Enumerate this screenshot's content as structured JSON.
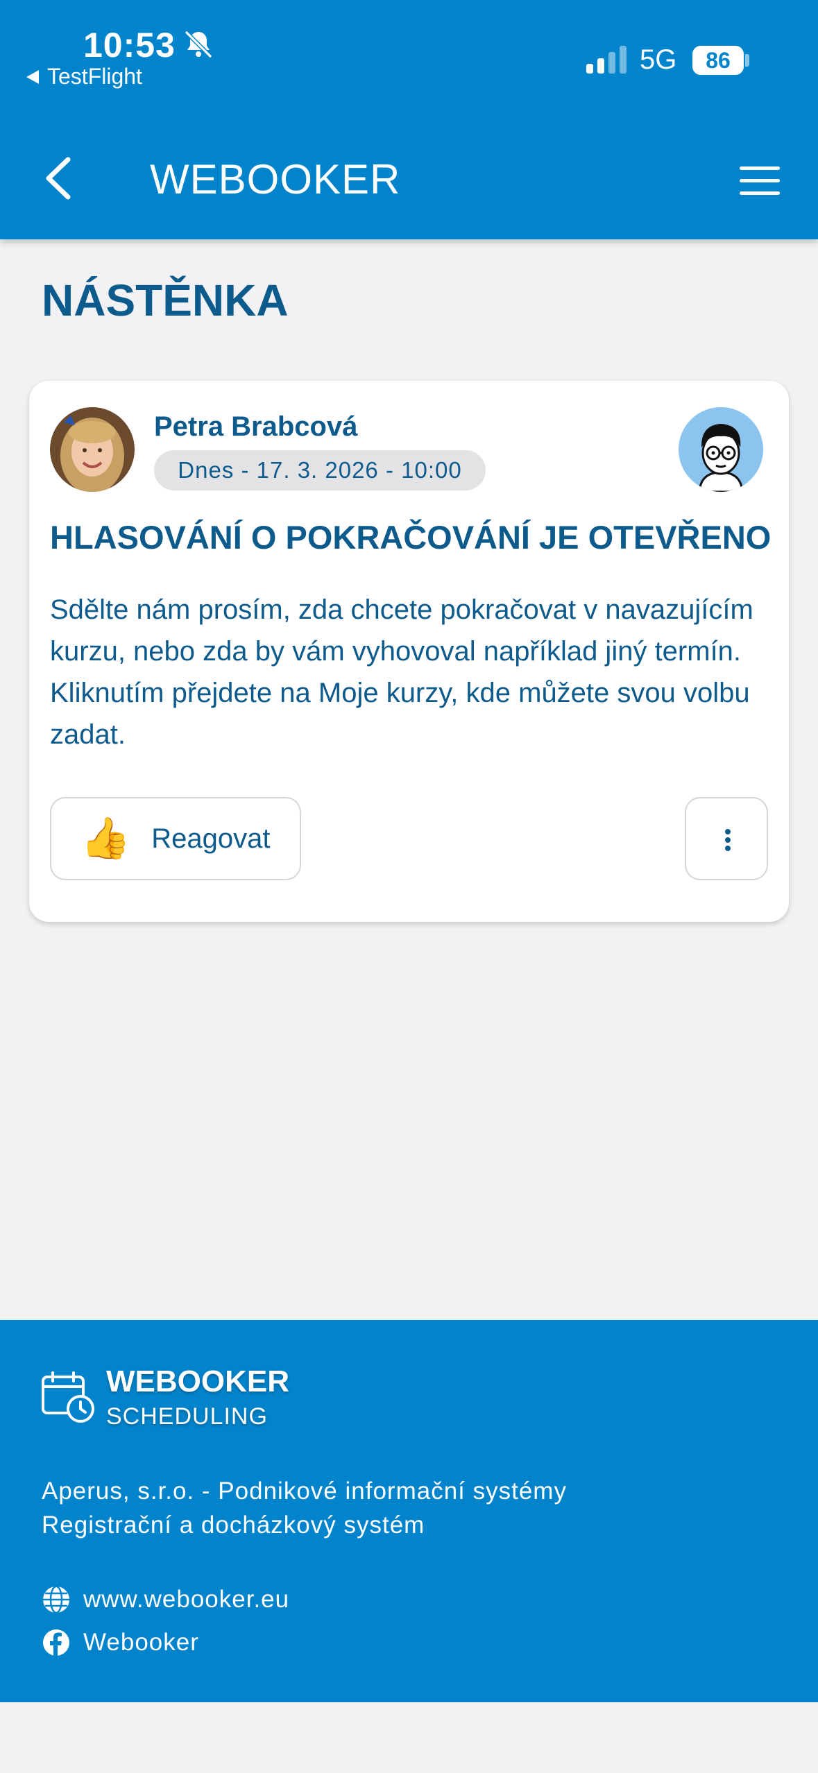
{
  "status_bar": {
    "time": "10:53",
    "back_app": "TestFlight",
    "network": "5G",
    "battery": "86"
  },
  "header": {
    "title": "WEBOOKER"
  },
  "page": {
    "title": "NÁSTĚNKA"
  },
  "post": {
    "author": "Petra Brabcová",
    "date": "Dnes - 17. 3. 2026 - 10:00",
    "title": "HLASOVÁNÍ O POKRAČOVÁNÍ JE OTEVŘENO",
    "body": "Sdělte nám prosím, zda chcete pokračovat v navazujícím kurzu, nebo zda by vám vyhovoval například jiný termín. Kliknutím přejdete na Moje kurzy, kde můžete svou volbu zadat.",
    "react_label": "Reagovat",
    "react_icon": "thumbs-up-icon"
  },
  "footer": {
    "brand": "WEBOOKER",
    "subtitle": "SCHEDULING",
    "company": "Aperus, s.r.o. - Podnikové informační systémy",
    "tagline": "Registrační a docházkový systém",
    "website": "www.webooker.eu",
    "facebook": "Webooker"
  },
  "colors": {
    "primary": "#0284cc",
    "text": "#0d5a8c",
    "background": "#f2f2f4"
  }
}
